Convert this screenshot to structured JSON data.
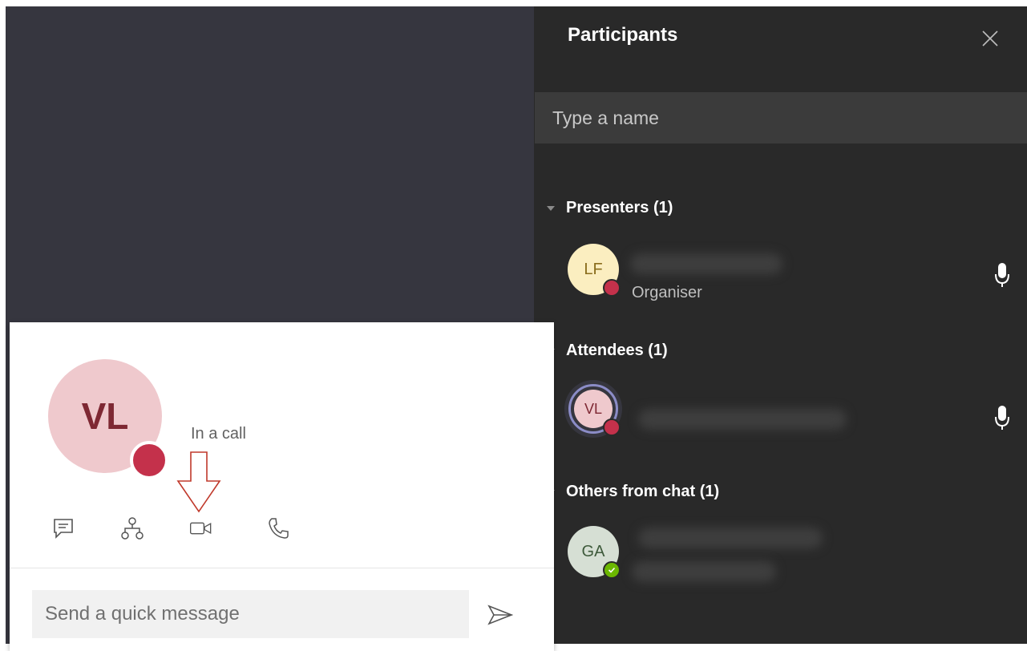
{
  "participants": {
    "title": "Participants",
    "search_placeholder": "Type a name",
    "sections": [
      {
        "label": "Presenters (1)"
      },
      {
        "label": "Attendees (1)"
      },
      {
        "label": "Others from chat (1)"
      }
    ],
    "people": [
      {
        "initials": "LF",
        "role": "Organiser",
        "avatar_color": "#fbeec0",
        "text_color": "#8a6d1d",
        "status_color": "#c4314b"
      },
      {
        "initials": "VL",
        "role": "",
        "avatar_color": "#efc9cd",
        "text_color": "#7e2833",
        "status_color": "#c4314b"
      },
      {
        "initials": "GA",
        "role": "",
        "avatar_color": "#d6dfd4",
        "text_color": "#3e5a3b",
        "status_color": "#6bb700"
      }
    ]
  },
  "contact_card": {
    "initials": "VL",
    "status_text": "In a call",
    "status_color": "#c4314b",
    "actions": [
      "chat-icon",
      "org-chart-icon",
      "video-call-icon",
      "audio-call-icon"
    ],
    "message_placeholder": "Send a quick message"
  }
}
